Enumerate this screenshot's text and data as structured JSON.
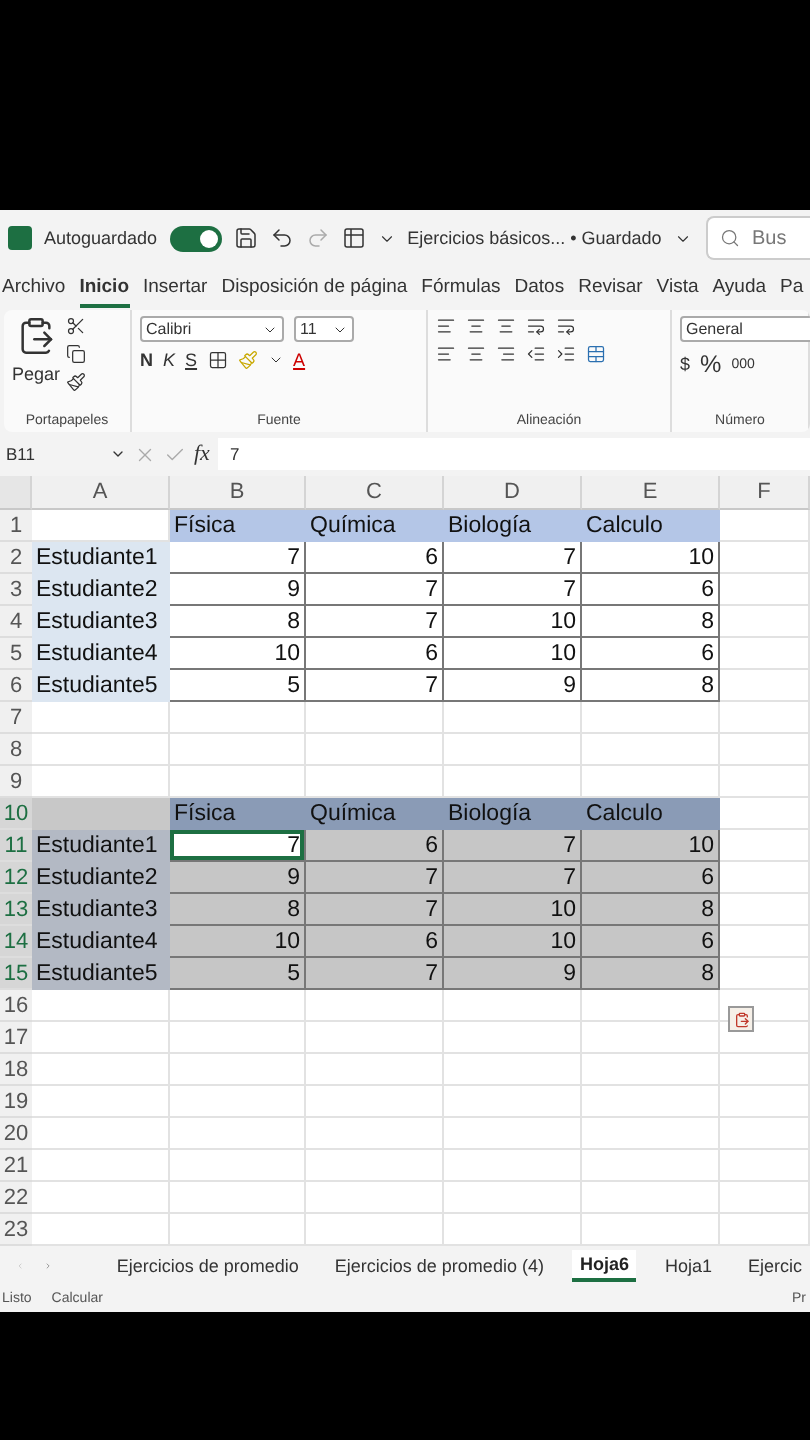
{
  "title_bar": {
    "autosave_label": "Autoguardado",
    "autosave_on": true,
    "document_title": "Ejercicios básicos... • Guardado",
    "search_placeholder": "Bus"
  },
  "menu": [
    {
      "label": "Archivo",
      "selected": false
    },
    {
      "label": "Inicio",
      "selected": true
    },
    {
      "label": "Insertar",
      "selected": false
    },
    {
      "label": "Disposición de página",
      "selected": false
    },
    {
      "label": "Fórmulas",
      "selected": false
    },
    {
      "label": "Datos",
      "selected": false
    },
    {
      "label": "Revisar",
      "selected": false
    },
    {
      "label": "Vista",
      "selected": false
    },
    {
      "label": "Ayuda",
      "selected": false
    },
    {
      "label": "Pa",
      "selected": false
    }
  ],
  "ribbon": {
    "paste_label": "Pegar",
    "clipboard_group": "Portapapeles",
    "font_name": "Calibri",
    "font_size": "11",
    "bold": "N",
    "italic": "K",
    "underline": "S",
    "font_color": "A",
    "font_group": "Fuente",
    "alignment_group": "Alineación",
    "number_format": "General",
    "currency": "$",
    "percent": "%",
    "thousands": "000",
    "number_group": "Número"
  },
  "formula_bar": {
    "name_box": "B11",
    "fx": "fx",
    "value": "7"
  },
  "grid": {
    "columns": [
      "A",
      "B",
      "C",
      "D",
      "E",
      "F"
    ],
    "rows": [
      {
        "number": "1",
        "kind": "header",
        "selected": false,
        "cells": [
          {
            "text": "",
            "active": false
          },
          {
            "text": "Física",
            "active": false
          },
          {
            "text": "Química",
            "active": false
          },
          {
            "text": "Biología",
            "active": false
          },
          {
            "text": "Calculo",
            "active": false
          }
        ]
      },
      {
        "number": "2",
        "kind": "data",
        "selected": false,
        "cells": [
          {
            "text": "Estudiante1",
            "active": false
          },
          {
            "text": "7",
            "active": false
          },
          {
            "text": "6",
            "active": false
          },
          {
            "text": "7",
            "active": false
          },
          {
            "text": "10",
            "active": false
          }
        ]
      },
      {
        "number": "3",
        "kind": "data",
        "selected": false,
        "cells": [
          {
            "text": "Estudiante2",
            "active": false
          },
          {
            "text": "9",
            "active": false
          },
          {
            "text": "7",
            "active": false
          },
          {
            "text": "7",
            "active": false
          },
          {
            "text": "6",
            "active": false
          }
        ]
      },
      {
        "number": "4",
        "kind": "data",
        "selected": false,
        "cells": [
          {
            "text": "Estudiante3",
            "active": false
          },
          {
            "text": "8",
            "active": false
          },
          {
            "text": "7",
            "active": false
          },
          {
            "text": "10",
            "active": false
          },
          {
            "text": "8",
            "active": false
          }
        ]
      },
      {
        "number": "5",
        "kind": "data",
        "selected": false,
        "cells": [
          {
            "text": "Estudiante4",
            "active": false
          },
          {
            "text": "10",
            "active": false
          },
          {
            "text": "6",
            "active": false
          },
          {
            "text": "10",
            "active": false
          },
          {
            "text": "6",
            "active": false
          }
        ]
      },
      {
        "number": "6",
        "kind": "data",
        "selected": false,
        "cells": [
          {
            "text": "Estudiante5",
            "active": false
          },
          {
            "text": "5",
            "active": false
          },
          {
            "text": "7",
            "active": false
          },
          {
            "text": "9",
            "active": false
          },
          {
            "text": "8",
            "active": false
          }
        ]
      },
      {
        "number": "7",
        "kind": "empty",
        "selected": false
      },
      {
        "number": "8",
        "kind": "empty",
        "selected": false
      },
      {
        "number": "9",
        "kind": "empty",
        "selected": false
      },
      {
        "number": "10",
        "kind": "header",
        "selected": true,
        "cells": [
          {
            "text": "",
            "active": false
          },
          {
            "text": "Física",
            "active": false
          },
          {
            "text": "Química",
            "active": false
          },
          {
            "text": "Biología",
            "active": false
          },
          {
            "text": "Calculo",
            "active": false
          }
        ]
      },
      {
        "number": "11",
        "kind": "data",
        "selected": true,
        "cells": [
          {
            "text": "Estudiante1",
            "active": false
          },
          {
            "text": "7",
            "active": true
          },
          {
            "text": "6",
            "active": false
          },
          {
            "text": "7",
            "active": false
          },
          {
            "text": "10",
            "active": false
          }
        ]
      },
      {
        "number": "12",
        "kind": "data",
        "selected": true,
        "cells": [
          {
            "text": "Estudiante2",
            "active": false
          },
          {
            "text": "9",
            "active": false
          },
          {
            "text": "7",
            "active": false
          },
          {
            "text": "7",
            "active": false
          },
          {
            "text": "6",
            "active": false
          }
        ]
      },
      {
        "number": "13",
        "kind": "data",
        "selected": true,
        "cells": [
          {
            "text": "Estudiante3",
            "active": false
          },
          {
            "text": "8",
            "active": false
          },
          {
            "text": "7",
            "active": false
          },
          {
            "text": "10",
            "active": false
          },
          {
            "text": "8",
            "active": false
          }
        ]
      },
      {
        "number": "14",
        "kind": "data",
        "selected": true,
        "cells": [
          {
            "text": "Estudiante4",
            "active": false
          },
          {
            "text": "10",
            "active": false
          },
          {
            "text": "6",
            "active": false
          },
          {
            "text": "10",
            "active": false
          },
          {
            "text": "6",
            "active": false
          }
        ]
      },
      {
        "number": "15",
        "kind": "data",
        "selected": true,
        "cells": [
          {
            "text": "Estudiante5",
            "active": false
          },
          {
            "text": "5",
            "active": false
          },
          {
            "text": "7",
            "active": false
          },
          {
            "text": "9",
            "active": false
          },
          {
            "text": "8",
            "active": false
          }
        ]
      },
      {
        "number": "16",
        "kind": "empty",
        "selected": false
      },
      {
        "number": "17",
        "kind": "empty",
        "selected": false
      },
      {
        "number": "18",
        "kind": "empty",
        "selected": false
      },
      {
        "number": "19",
        "kind": "empty",
        "selected": false
      },
      {
        "number": "20",
        "kind": "empty",
        "selected": false
      },
      {
        "number": "21",
        "kind": "empty",
        "selected": false
      },
      {
        "number": "22",
        "kind": "empty",
        "selected": false
      },
      {
        "number": "23",
        "kind": "empty",
        "selected": false
      }
    ]
  },
  "sheet_tabs": [
    {
      "label": "Ejercicios de promedio",
      "selected": false
    },
    {
      "label": "Ejercicios de promedio (4)",
      "selected": false
    },
    {
      "label": "Hoja6",
      "selected": true
    },
    {
      "label": "Hoja1",
      "selected": false
    },
    {
      "label": "Ejercic",
      "selected": false
    }
  ],
  "status_bar": {
    "state": "Listo",
    "calculate": "Calcular",
    "right": "Pr"
  }
}
